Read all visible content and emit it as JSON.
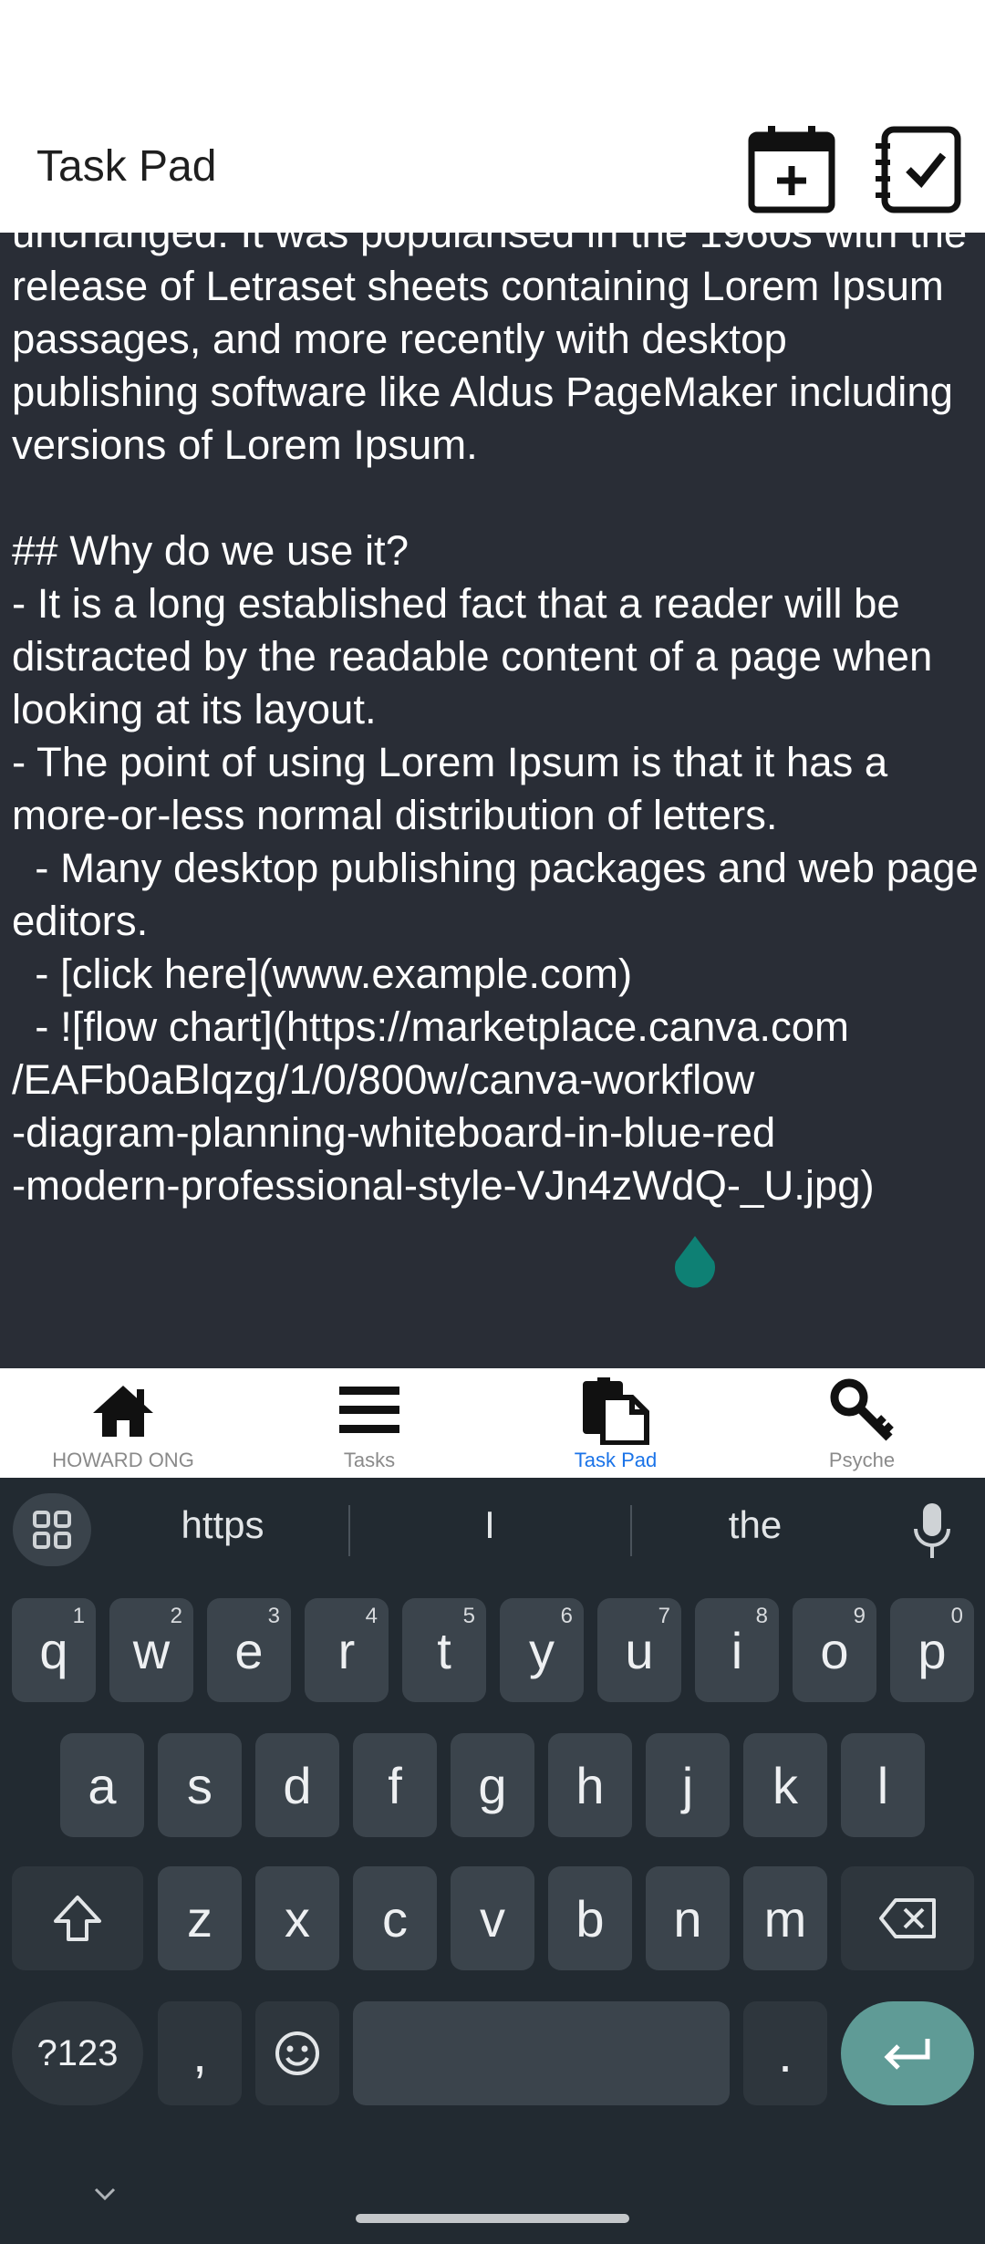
{
  "app_bar": {
    "title": "Task Pad",
    "icons": [
      "calendar-add-icon",
      "checklist-icon"
    ]
  },
  "editor": {
    "text": "unchanged. It was popularised in the 1960s with the release of Letraset sheets containing Lorem Ipsum passages, and more recently with desktop publishing software like Aldus PageMaker including versions of Lorem Ipsum.\n\n## Why do we use it?\n- It is a long established fact that a reader will be distracted by the readable content of a page when looking at its layout.\n- The point of using Lorem Ipsum is that it has a more-or-less normal distribution of letters.\n  - Many desktop publishing packages and web page editors.\n  - [click here](www.example.com)\n  - ![flow chart](https://marketplace.canva.com\n/EAFb0aBlqzg/1/0/800w/canva-workflow\n-diagram-planning-whiteboard-in-blue-red\n-modern-professional-style-VJn4zWdQ-_U.jpg)"
  },
  "bottom_nav": {
    "items": [
      {
        "label": "HOWARD ONG",
        "icon": "home-icon"
      },
      {
        "label": "Tasks",
        "icon": "menu-icon"
      },
      {
        "label": "Task Pad",
        "icon": "notepad-icon"
      },
      {
        "label": "Psyche",
        "icon": "key-icon"
      }
    ],
    "active": "Task Pad",
    "active_color": "#1a73e8"
  },
  "keyboard": {
    "suggestions": [
      "https",
      "I",
      "the"
    ],
    "row1": [
      {
        "key": "q",
        "hint": "1"
      },
      {
        "key": "w",
        "hint": "2"
      },
      {
        "key": "e",
        "hint": "3"
      },
      {
        "key": "r",
        "hint": "4"
      },
      {
        "key": "t",
        "hint": "5"
      },
      {
        "key": "y",
        "hint": "6"
      },
      {
        "key": "u",
        "hint": "7"
      },
      {
        "key": "i",
        "hint": "8"
      },
      {
        "key": "o",
        "hint": "9"
      },
      {
        "key": "p",
        "hint": "0"
      }
    ],
    "row2": [
      "a",
      "s",
      "d",
      "f",
      "g",
      "h",
      "j",
      "k",
      "l"
    ],
    "row3": [
      "z",
      "x",
      "c",
      "v",
      "b",
      "n",
      "m"
    ],
    "symbols_label": "?123",
    "comma_label": ",",
    "period_label": ".",
    "enter_color": "#5f9b96"
  }
}
